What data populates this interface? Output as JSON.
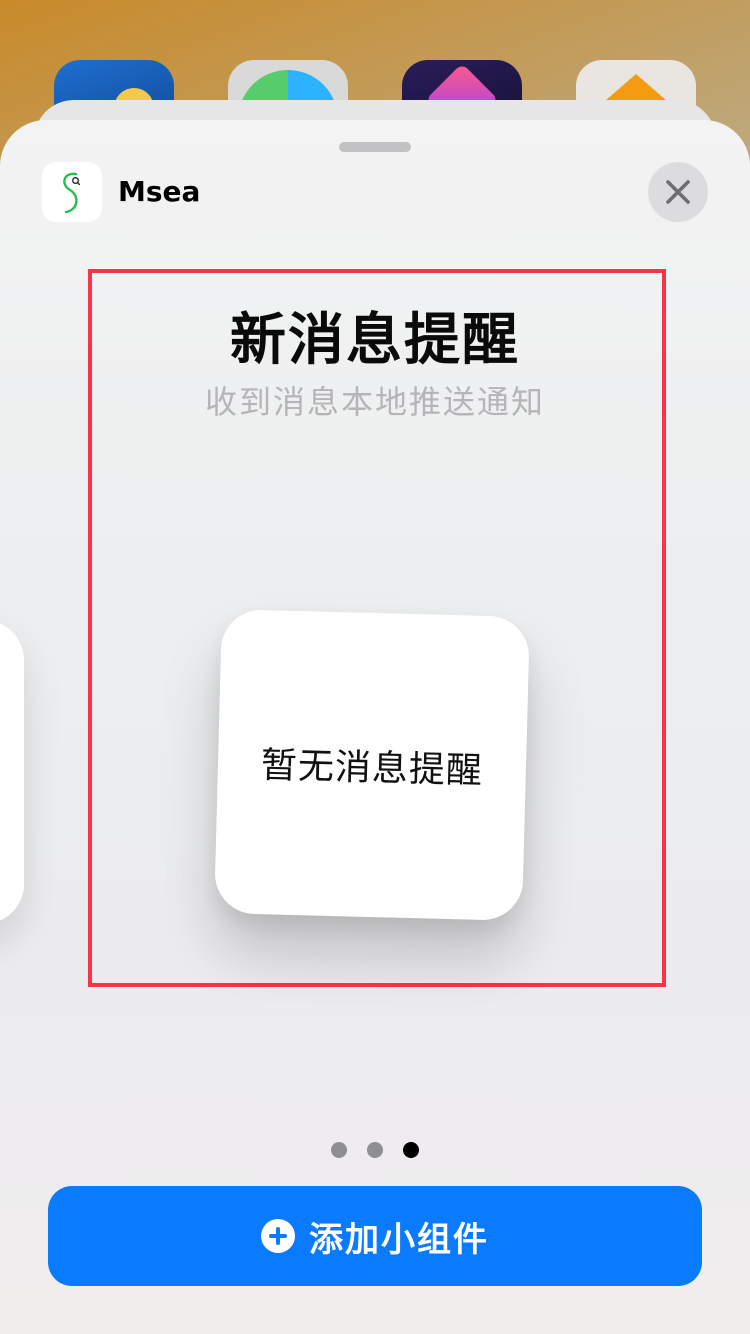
{
  "sheet": {
    "app_name": "Msea",
    "app_icon": "msea-logo-icon",
    "close_icon": "close-icon"
  },
  "widget_preview": {
    "title": "新消息提醒",
    "subtitle": "收到消息本地推送通知",
    "widget_text": "暂无消息提醒"
  },
  "pager": {
    "total_pages": 3,
    "current_page": 3
  },
  "actions": {
    "add_label": "添加小组件",
    "add_icon": "plus-circle-icon"
  },
  "colors": {
    "accent": "#0a7bff",
    "highlight_frame": "#fa3448",
    "logo_green": "#22c24a"
  }
}
